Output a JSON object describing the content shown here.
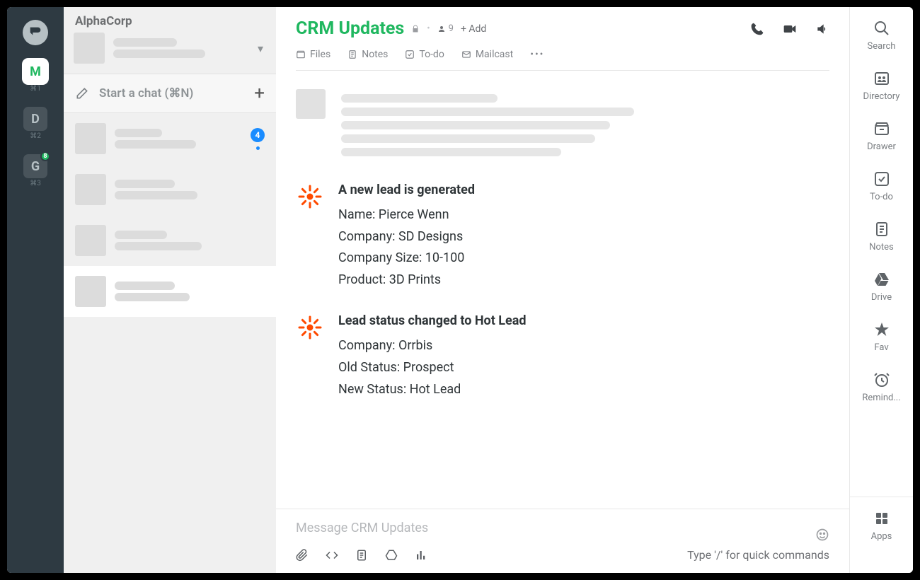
{
  "rail": {
    "workspaces": [
      {
        "letter": "M",
        "kbd": "⌘1",
        "active": true
      },
      {
        "letter": "D",
        "kbd": "⌘2"
      },
      {
        "letter": "G",
        "kbd": "⌘3",
        "badge": "8"
      }
    ]
  },
  "sidebar": {
    "org": "AlphaCorp",
    "start_chat": "Start a chat (⌘N)",
    "chats": [
      {
        "badge": "4"
      },
      {},
      {},
      {
        "active": true
      }
    ]
  },
  "header": {
    "title": "CRM Updates",
    "people": "9",
    "add": "+ Add",
    "tabs": {
      "files": "Files",
      "notes": "Notes",
      "todo": "To-do",
      "mailcast": "Mailcast"
    }
  },
  "messages": [
    {
      "title": "A new lead is generated",
      "lines": [
        "Name: Pierce Wenn",
        "Company: SD Designs",
        "Company Size: 10-100",
        "Product: 3D Prints"
      ]
    },
    {
      "title": "Lead status changed to Hot Lead",
      "lines": [
        "Company: Orrbis",
        "Old Status: Prospect",
        "New Status: Hot Lead"
      ]
    }
  ],
  "composer": {
    "placeholder": "Message CRM Updates",
    "hint": "Type '/' for quick commands"
  },
  "rrail": {
    "search": "Search",
    "directory": "Directory",
    "drawer": "Drawer",
    "todo": "To-do",
    "notes": "Notes",
    "drive": "Drive",
    "fav": "Fav",
    "remind": "Remind...",
    "apps": "Apps"
  }
}
